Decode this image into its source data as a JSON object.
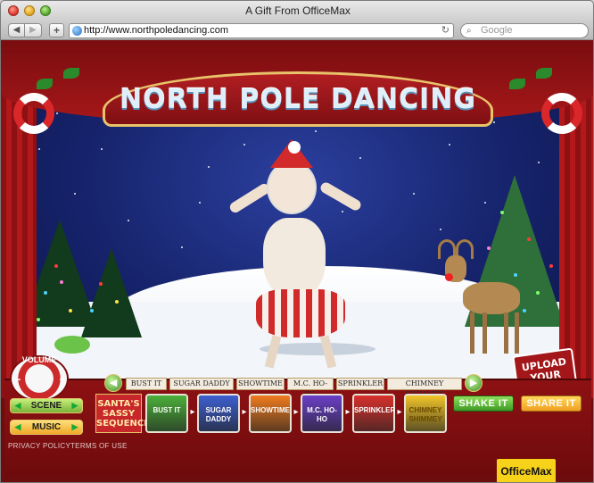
{
  "window": {
    "title": "A Gift From OfficeMax"
  },
  "toolbar": {
    "url": "http://www.northpoledancing.com",
    "search_placeholder": "Google",
    "back_icon": "chevron-left-icon",
    "forward_icon": "chevron-right-icon",
    "add_icon": "plus-icon",
    "reload_icon": "reload-icon"
  },
  "site": {
    "banner_title": "NORTH POLE DANCING",
    "upload_label": "UPLOAD YOUR FACE",
    "volume_label": "VOLUME",
    "volume_minus": "−",
    "volume_plus": "+",
    "scene_label": "SCENE",
    "music_label": "MUSIC",
    "moves": [
      "BUST IT",
      "SUGAR DADDY",
      "SHOWTIME",
      "M.C. HO-HO",
      "SPRINKLER",
      "CHIMNEY SHIMMEY"
    ],
    "sequence_label": "SANTA'S SASSY SEQUENCE",
    "sequence": [
      {
        "label": "BUST IT",
        "color": "#4caf3a"
      },
      {
        "label": "SUGAR DADDY",
        "color": "#3d5fd0"
      },
      {
        "label": "SHOWTIME",
        "color": "#ef7b1e"
      },
      {
        "label": "M.C. HO-HO",
        "color": "#6a3fc6"
      },
      {
        "label": "SPRINKLER",
        "color": "#d8312c"
      },
      {
        "label": "CHIMNEY SHIMMEY",
        "color": "#f1c52a"
      }
    ],
    "shake_label": "SHAKE IT",
    "share_label": "SHARE IT",
    "privacy_label": "PRIVACY POLICY",
    "terms_label": "TERMS OF USE",
    "brand_label": "OfficeMax"
  },
  "colors": {
    "accent_red": "#a31619",
    "gold_trim": "#e8c36a",
    "sky": "#16236b"
  }
}
